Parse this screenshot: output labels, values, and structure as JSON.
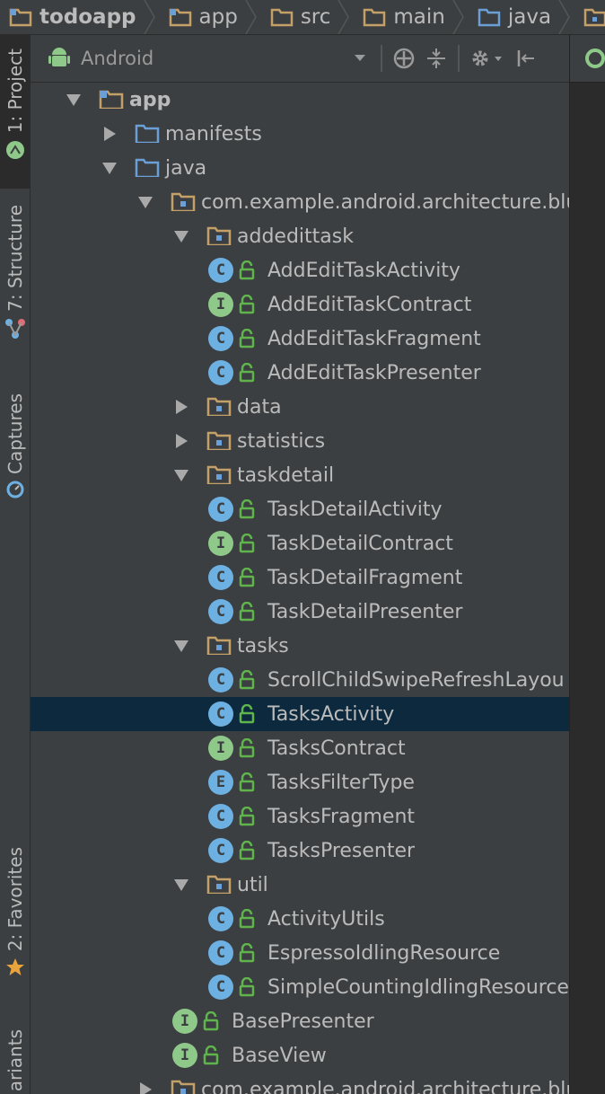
{
  "breadcrumb": [
    "todoapp",
    "app",
    "src",
    "main",
    "java",
    "com"
  ],
  "sidebar_tabs": {
    "project": "1: Project",
    "structure": "7: Structure",
    "captures": "Captures",
    "favorites": "2: Favorites",
    "variants": "ariants"
  },
  "toolbar": {
    "view_mode": "Android"
  },
  "colors": {
    "class_icon": "#6db1e2",
    "interface_icon": "#8fc98a",
    "enum_icon": "#6db1e2",
    "folder": "#c2a068",
    "module_folder": "#6a9fd8",
    "lock": "#5fb54c",
    "selection": "#0d293e"
  },
  "tree": [
    {
      "label": "app",
      "depth": 0,
      "expanded": true,
      "icon": "module-folder-icon",
      "bold": true
    },
    {
      "label": "manifests",
      "depth": 1,
      "expanded": false,
      "icon": "blue-folder-icon"
    },
    {
      "label": "java",
      "depth": 1,
      "expanded": true,
      "icon": "blue-folder-icon"
    },
    {
      "label": "com.example.android.architecture.blue",
      "depth": 2,
      "expanded": true,
      "icon": "package-icon"
    },
    {
      "label": "addedittask",
      "depth": 3,
      "expanded": true,
      "icon": "package-icon"
    },
    {
      "label": "AddEditTaskActivity",
      "depth": 4,
      "kind": "C"
    },
    {
      "label": "AddEditTaskContract",
      "depth": 4,
      "kind": "I"
    },
    {
      "label": "AddEditTaskFragment",
      "depth": 4,
      "kind": "C"
    },
    {
      "label": "AddEditTaskPresenter",
      "depth": 4,
      "kind": "C"
    },
    {
      "label": "data",
      "depth": 3,
      "expanded": false,
      "icon": "package-icon"
    },
    {
      "label": "statistics",
      "depth": 3,
      "expanded": false,
      "icon": "package-icon"
    },
    {
      "label": "taskdetail",
      "depth": 3,
      "expanded": true,
      "icon": "package-icon"
    },
    {
      "label": "TaskDetailActivity",
      "depth": 4,
      "kind": "C"
    },
    {
      "label": "TaskDetailContract",
      "depth": 4,
      "kind": "I"
    },
    {
      "label": "TaskDetailFragment",
      "depth": 4,
      "kind": "C"
    },
    {
      "label": "TaskDetailPresenter",
      "depth": 4,
      "kind": "C"
    },
    {
      "label": "tasks",
      "depth": 3,
      "expanded": true,
      "icon": "package-icon"
    },
    {
      "label": "ScrollChildSwipeRefreshLayou",
      "depth": 4,
      "kind": "C"
    },
    {
      "label": "TasksActivity",
      "depth": 4,
      "kind": "C",
      "selected": true
    },
    {
      "label": "TasksContract",
      "depth": 4,
      "kind": "I"
    },
    {
      "label": "TasksFilterType",
      "depth": 4,
      "kind": "E"
    },
    {
      "label": "TasksFragment",
      "depth": 4,
      "kind": "C"
    },
    {
      "label": "TasksPresenter",
      "depth": 4,
      "kind": "C"
    },
    {
      "label": "util",
      "depth": 3,
      "expanded": true,
      "icon": "package-icon"
    },
    {
      "label": "ActivityUtils",
      "depth": 4,
      "kind": "C"
    },
    {
      "label": "EspressoIdlingResource",
      "depth": 4,
      "kind": "C"
    },
    {
      "label": "SimpleCountingIdlingResource",
      "depth": 4,
      "kind": "C"
    },
    {
      "label": "BasePresenter",
      "depth": 3,
      "kind": "I"
    },
    {
      "label": "BaseView",
      "depth": 3,
      "kind": "I"
    },
    {
      "label": "com.example.android.architecture.blue",
      "depth": 2,
      "expanded": false,
      "icon": "package-icon"
    }
  ]
}
